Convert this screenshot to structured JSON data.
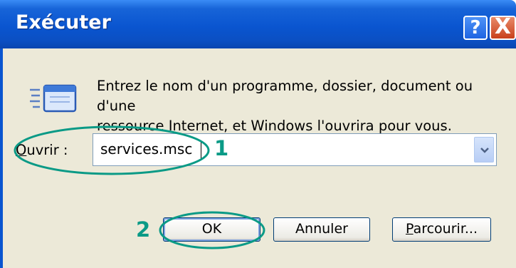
{
  "window": {
    "title": "Exécuter",
    "help_glyph": "?",
    "close_glyph": "X"
  },
  "dialog": {
    "icon": "run-window-icon",
    "description": "Entrez le nom d'un programme, dossier, document ou d'une\nressource Internet, et Windows l'ouvrira pour vous.",
    "open_label_prefix": "O",
    "open_label_rest": "uvrir :",
    "open_value": "services.msc",
    "buttons": {
      "ok": "OK",
      "cancel": "Annuler",
      "browse_prefix": "P",
      "browse_rest": "arcourir..."
    }
  },
  "annotations": {
    "step1": "1",
    "step2": "2",
    "color": "#0a9a86"
  }
}
